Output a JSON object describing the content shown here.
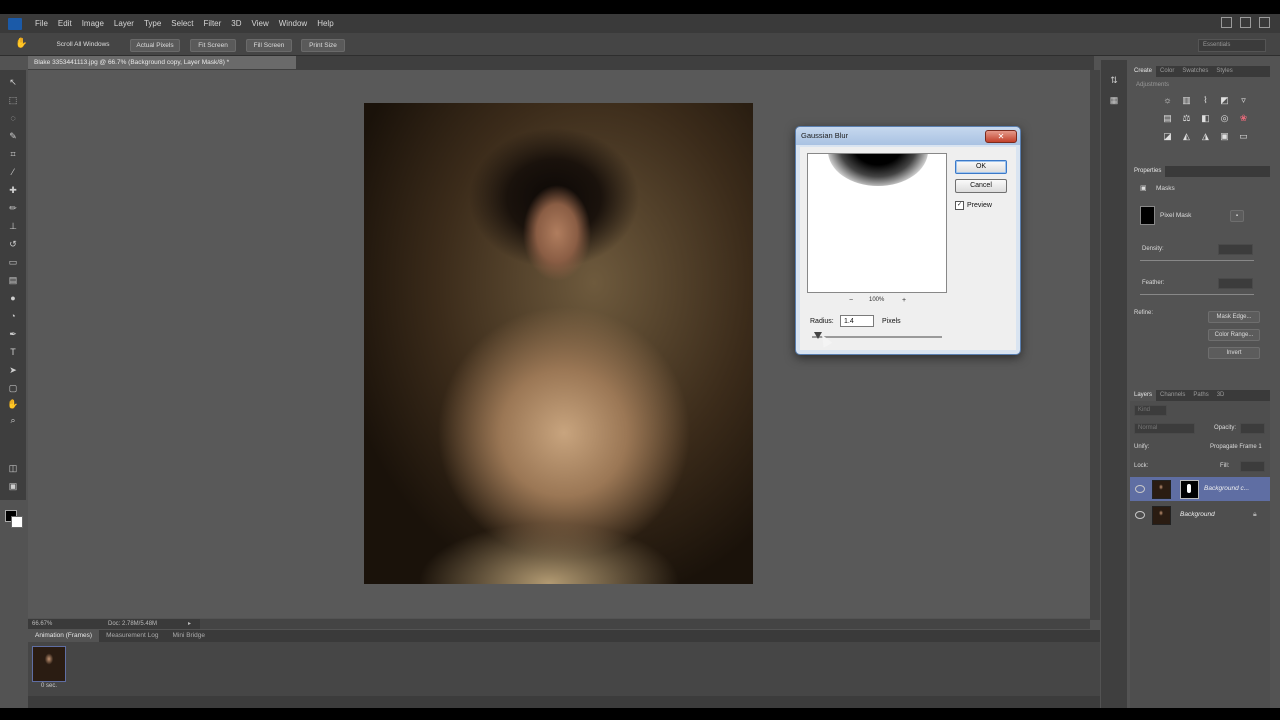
{
  "menu": [
    "File",
    "Edit",
    "Image",
    "Layer",
    "Type",
    "Select",
    "Filter",
    "3D",
    "View",
    "Window",
    "Help"
  ],
  "options_bar": {
    "scroll_all_windows": "Scroll All Windows",
    "actual_pixels": "Actual Pixels",
    "fit_screen": "Fit Screen",
    "fill_screen": "Fill Screen",
    "print_size": "Print Size",
    "workspace": "Essentials"
  },
  "document": {
    "tab_title": "Blake 3353441113.jpg @ 66.7% (Background copy, Layer Mask/8) *",
    "zoom_status": "66.67%",
    "doc_size": "Doc: 2.78M/5.48M"
  },
  "timeline": {
    "tabs": [
      "Animation (Frames)",
      "Measurement Log",
      "Mini Bridge"
    ],
    "frame_label": "0 sec."
  },
  "dialog": {
    "title": "Gaussian Blur",
    "ok": "OK",
    "cancel": "Cancel",
    "preview_label": "Preview",
    "zoom_value": "100%",
    "radius_label": "Radius:",
    "radius_value": "1.4",
    "radius_unit": "Pixels"
  },
  "adjustments_panel": {
    "tabs": [
      "Create",
      "Color",
      "Swatches",
      "Styles"
    ],
    "add_label": "Adjustments"
  },
  "properties_panel": {
    "tab": "Properties",
    "section": "Masks",
    "mask_type": "Pixel Mask",
    "density_label": "Density:",
    "feather_label": "Feather:",
    "refine_label": "Refine:",
    "mask_edge": "Mask Edge...",
    "color_range": "Color Range...",
    "invert": "Invert"
  },
  "layers_panel": {
    "tabs": [
      "Layers",
      "Channels",
      "Paths",
      "3D"
    ],
    "kind": "Kind",
    "blend_mode": "Normal",
    "opacity_label": "Opacity:",
    "unify_label": "Unify:",
    "propagate_label": "Propagate Frame 1",
    "lock_label": "Lock:",
    "fill_label": "Fill:",
    "layers": [
      {
        "name": "Background c...",
        "selected": true
      },
      {
        "name": "Background",
        "selected": false
      }
    ]
  }
}
